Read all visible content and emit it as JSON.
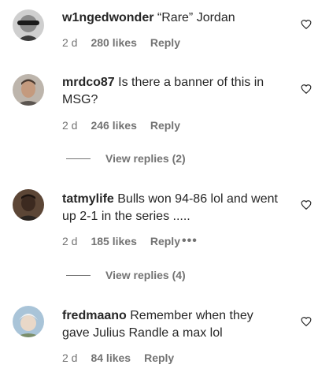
{
  "comments": [
    {
      "user": "w1ngedwonder",
      "text": "“Rare” Jordan",
      "time": "2 d",
      "likes": "280 likes",
      "reply": "Reply"
    },
    {
      "user": "mrdco87",
      "text": "Is there a banner of this in MSG?",
      "time": "2 d",
      "likes": "246 likes",
      "reply": "Reply",
      "view_replies": "View replies (2)"
    },
    {
      "user": "tatmylife",
      "text": "Bulls won 94-86 lol and went up 2-1 in the series .....",
      "time": "2 d",
      "likes": "185 likes",
      "reply": "Reply",
      "more": "•••",
      "view_replies": "View replies (4)"
    },
    {
      "user": "fredmaano",
      "text": "Remember when they gave Julius Randle a max lol",
      "time": "2 d",
      "likes": "84 likes",
      "reply": "Reply"
    }
  ],
  "icons": {
    "like": "heart-outline-icon",
    "more": "more-options-icon"
  },
  "colors": {
    "text": "#262626",
    "secondary": "#737373"
  }
}
